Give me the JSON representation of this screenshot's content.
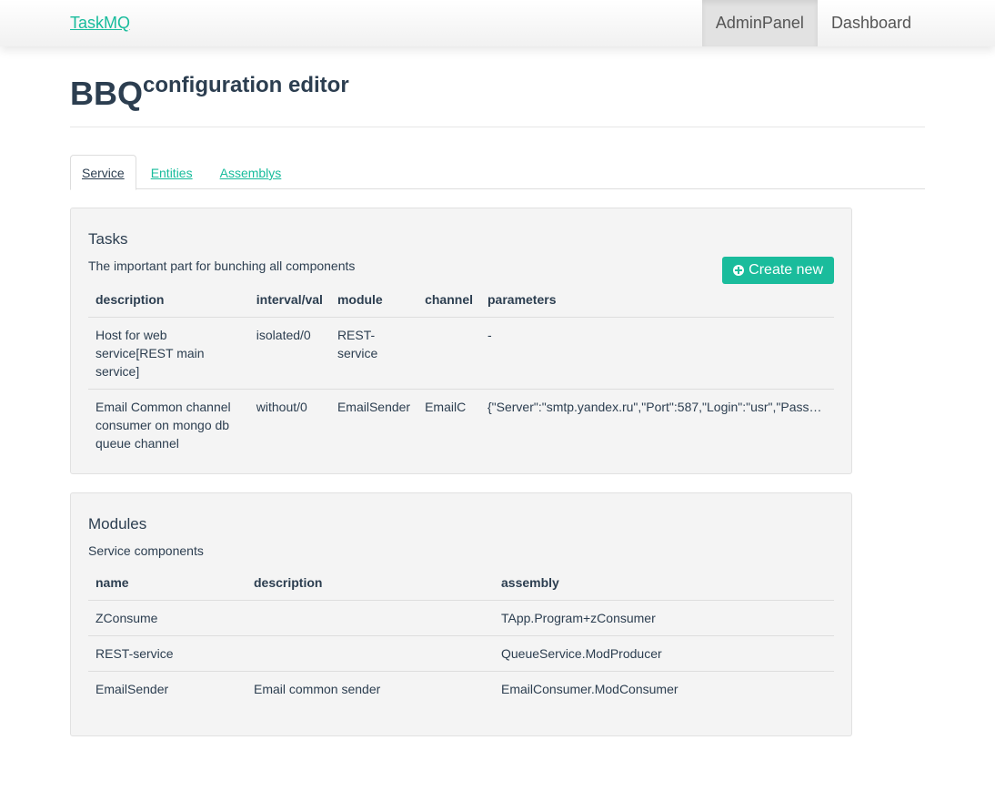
{
  "navbar": {
    "brand": "TaskMQ",
    "items": [
      {
        "label": "AdminPanel",
        "active": true
      },
      {
        "label": "Dashboard",
        "active": false
      }
    ]
  },
  "header": {
    "title": "BBQ",
    "subtitle": "configuration editor"
  },
  "tabs": [
    {
      "label": "Service",
      "active": true
    },
    {
      "label": "Entities",
      "active": false
    },
    {
      "label": "Assemblys",
      "active": false
    }
  ],
  "tasks": {
    "title": "Tasks",
    "description": "The important part for bunching all components",
    "create_button": "Create new",
    "columns": [
      "description",
      "interval/val",
      "module",
      "channel",
      "parameters"
    ],
    "rows": [
      {
        "description": "Host for web service[REST main service]",
        "interval": "isolated/0",
        "module": "REST-service",
        "channel": "",
        "parameters": "-"
      },
      {
        "description": "Email Common channel consumer on mongo db queue channel",
        "interval": "without/0",
        "module": "EmailSender",
        "channel": "EmailC",
        "parameters": "{\"Server\":\"smtp.yandex.ru\",\"Port\":587,\"Login\":\"usr\",\"Passwor..."
      }
    ]
  },
  "modules": {
    "title": "Modules",
    "description": "Service components",
    "columns": [
      "name",
      "description",
      "assembly"
    ],
    "rows": [
      {
        "name": "ZConsume",
        "description": "",
        "assembly": "TApp.Program+zConsumer"
      },
      {
        "name": "REST-service",
        "description": "",
        "assembly": "QueueService.ModProducer"
      },
      {
        "name": "EmailSender",
        "description": "Email common sender",
        "assembly": "EmailConsumer.ModConsumer"
      }
    ]
  },
  "colors": {
    "accent": "#18bc9c",
    "text": "#2c3e50"
  }
}
